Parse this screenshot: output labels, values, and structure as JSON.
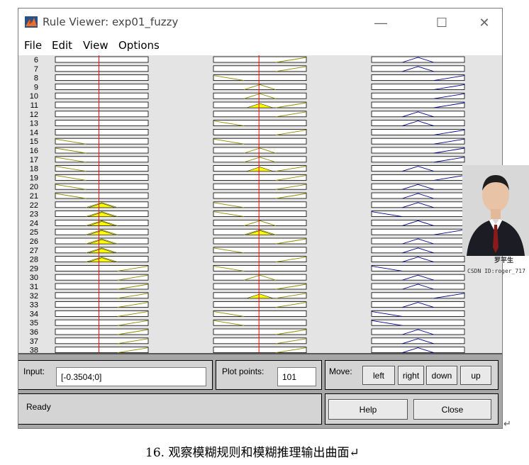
{
  "window": {
    "title": "Rule Viewer: exp01_fuzzy",
    "controls": {
      "minimize": "—",
      "maximize": "☐",
      "close": "✕"
    }
  },
  "menu": [
    "File",
    "Edit",
    "View",
    "Options"
  ],
  "rules": {
    "first_index": 6,
    "last_index": 38,
    "input1_line": 0.47,
    "input2_line": 0.49,
    "input1_mf": [
      "-",
      "-",
      "-",
      "-",
      "-",
      "-",
      "-",
      "-",
      "-",
      "l",
      "l",
      "l",
      "l",
      "l",
      "l",
      "l",
      "c",
      "c",
      "c",
      "c",
      "c",
      "c",
      "c",
      "r",
      "r",
      "r",
      "r",
      "r",
      "r",
      "r",
      "r",
      "r",
      "r"
    ],
    "input2_mf": [
      "r",
      "r",
      "l",
      "c",
      "c",
      "r",
      "r",
      "l",
      "r",
      "l",
      "c",
      "c",
      "r",
      "r",
      "r",
      "r",
      "l",
      "l",
      "c",
      "c",
      "r",
      "l",
      "r",
      "l",
      "c",
      "r",
      "r",
      "r",
      "l",
      "l",
      "r",
      "r",
      "r"
    ],
    "output_mf": [
      "c",
      "c",
      "r",
      "r",
      "r",
      "r",
      "c",
      "c",
      "r",
      "r",
      "r",
      "r",
      "c",
      "r",
      "c",
      "c",
      "c",
      "l",
      "c",
      "r",
      "c",
      "c",
      "c",
      "l",
      "c",
      "c",
      "r",
      "c",
      "l",
      "l",
      "c",
      "c",
      "c"
    ],
    "input1_fired": [
      16,
      17,
      18,
      19,
      20,
      21,
      22
    ],
    "input2_fired": [
      5,
      12,
      19,
      26
    ]
  },
  "colors": {
    "input_mf": "#8b8b00",
    "output_mf": "#00008b",
    "fired": "#ffff00",
    "line": "#ff0000"
  },
  "panel": {
    "input_label": "Input:",
    "input_value": "[-0.3504;0]",
    "plot_label": "Plot points:",
    "plot_value": "101",
    "move_label": "Move:",
    "move_buttons": [
      "left",
      "right",
      "down",
      "up"
    ],
    "status": "Ready",
    "help": "Help",
    "close": "Close"
  },
  "overlay": {
    "signature": "罗平生",
    "id_text": "CSDN ID:roger_717",
    "return_mark": "↵"
  },
  "caption": "16. 观察模糊规则和模糊推理输出曲面↵"
}
